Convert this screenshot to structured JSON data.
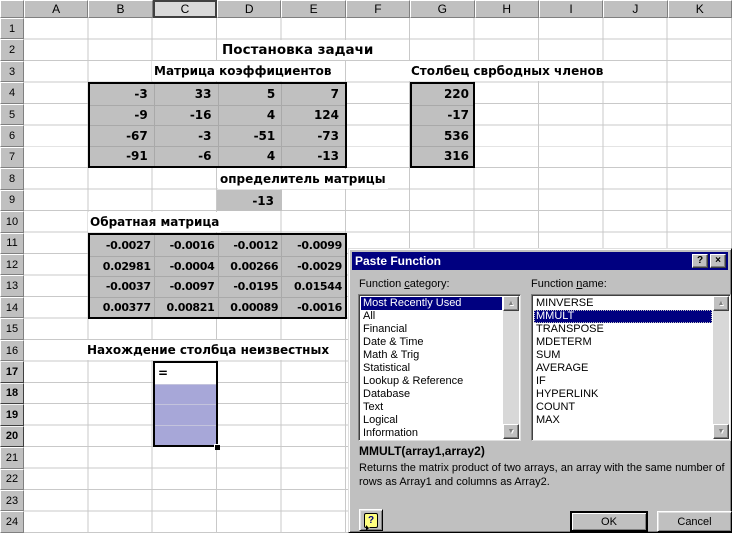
{
  "colors": {
    "titlebar": "#000080",
    "list_selection": "#000080",
    "cell_fill": "#c0c0c0",
    "range_selection_fill": "#a7a7d8",
    "gridline": "#c9c9c9"
  },
  "sheet": {
    "column_headers": [
      "A",
      "B",
      "C",
      "D",
      "E",
      "F",
      "G",
      "H",
      "I",
      "J",
      "K"
    ],
    "active_column": "C",
    "row_count": 24,
    "selected_rows": [
      17,
      18,
      19,
      20
    ],
    "labels": {
      "title": "Постановка задачи",
      "coefficients": "Матрица коэффициентов",
      "free_terms": "Столбец сврбодных членов",
      "determinant": "определитель матрицы",
      "inverse": "Обратная матрица",
      "unknowns": "Нахождение столбца неизвестных"
    },
    "coefficient_matrix": {
      "range": "B4:E7",
      "values": [
        [
          "-3",
          "33",
          "5",
          "7"
        ],
        [
          "-9",
          "-16",
          "4",
          "124"
        ],
        [
          "-67",
          "-3",
          "-51",
          "-73"
        ],
        [
          "-91",
          "-6",
          "4",
          "-13"
        ]
      ]
    },
    "free_terms_column": {
      "range": "G4:G7",
      "values": [
        "220",
        "-17",
        "536",
        "316"
      ]
    },
    "determinant_value": {
      "cell": "D9",
      "value": "-13"
    },
    "inverse_matrix": {
      "range": "B11:E14",
      "values": [
        [
          "-0.0027",
          "-0.0016",
          "-0.0012",
          "-0.0099"
        ],
        [
          "0.02981",
          "-0.0004",
          "0.00266",
          "-0.0029"
        ],
        [
          "-0.0037",
          "-0.0097",
          "-0.0195",
          "0.01544"
        ],
        [
          "0.00377",
          "0.00821",
          "0.00089",
          "-0.0016"
        ]
      ]
    },
    "selection": {
      "range": "C17:C20",
      "active_cell": "C17",
      "formula": "="
    }
  },
  "dialog": {
    "title": "Paste Function",
    "help_button": "?",
    "close_button": "×",
    "category_label": {
      "pre": "Function ",
      "key": "c",
      "post": "ategory:"
    },
    "name_label": {
      "pre": "Function ",
      "key": "n",
      "post": "ame:"
    },
    "categories": [
      "Most Recently Used",
      "All",
      "Financial",
      "Date & Time",
      "Math & Trig",
      "Statistical",
      "Lookup & Reference",
      "Database",
      "Text",
      "Logical",
      "Information"
    ],
    "selected_category": "Most Recently Used",
    "functions": [
      "MINVERSE",
      "MMULT",
      "TRANSPOSE",
      "MDETERM",
      "SUM",
      "AVERAGE",
      "IF",
      "HYPERLINK",
      "COUNT",
      "MAX"
    ],
    "selected_function": "MMULT",
    "signature": "MMULT(array1,array2)",
    "description": "Returns the matrix product of two arrays, an array with the same number of rows as Array1 and columns as Array2.",
    "help_icon": "?",
    "ok_label": "OK",
    "cancel_label": "Cancel",
    "scroll_up_glyph": "▲",
    "scroll_down_glyph": "▼"
  }
}
